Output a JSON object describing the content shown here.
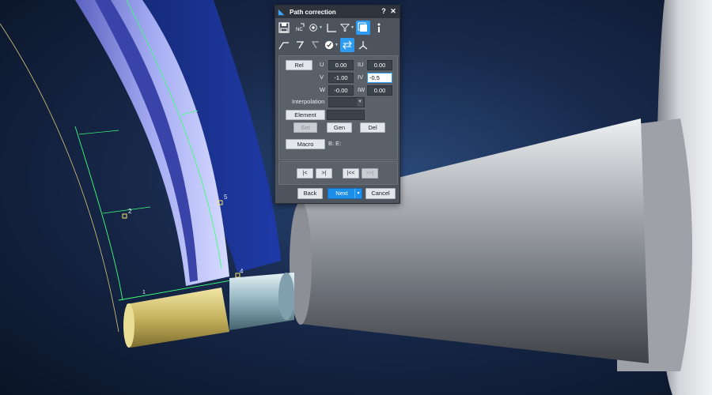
{
  "dialog": {
    "title": "Path correction",
    "help_label": "?",
    "close_label": "✕",
    "rel_button": "Rel",
    "fields": {
      "u": {
        "label": "U",
        "value": "0.00"
      },
      "iu": {
        "label": "IU",
        "value": "0.00"
      },
      "v": {
        "label": "V",
        "value": "-1.00"
      },
      "iv": {
        "label": "IV",
        "value": "-0.5"
      },
      "w": {
        "label": "W",
        "value": "-0.00"
      },
      "iw": {
        "label": "IW",
        "value": "0.00"
      }
    },
    "interpolation_label": "Interpolation",
    "element_button": "Element",
    "set_button": "Set",
    "gen_button": "Gen",
    "del_button": "Del",
    "macro_button": "Macro",
    "macro_info": "B: E:",
    "nav": {
      "prev": "|<",
      "next": ">|",
      "first": "|<<",
      "last": ">>|"
    },
    "footer": {
      "back": "Back",
      "next": "Next",
      "next_dropdown": "▾",
      "cancel": "Cancel"
    }
  },
  "scene": {
    "point_labels": [
      "5",
      "4",
      "2",
      "1"
    ]
  },
  "colors": {
    "accent": "#2c9bf0",
    "workpiece": "#8b93e0",
    "tool_holder": "#b8bcc2",
    "cutter": "#c9b868",
    "path_green": "#3dff7a"
  }
}
